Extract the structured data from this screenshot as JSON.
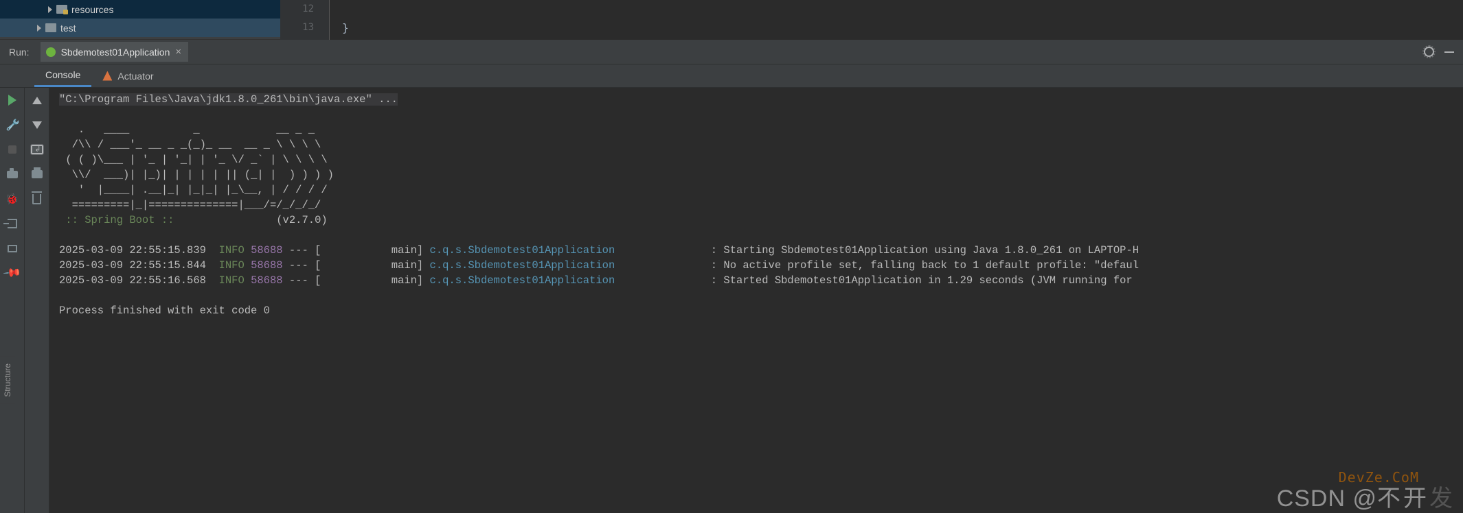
{
  "tree": {
    "items": [
      {
        "label": "resources",
        "special": true,
        "indent": 70
      },
      {
        "label": "test",
        "special": false,
        "indent": 54
      }
    ]
  },
  "gutter": {
    "l1": "12",
    "l2": "13"
  },
  "editor": {
    "l1": "",
    "l2": "}"
  },
  "run": {
    "label": "Run:",
    "tab": "Sbdemotest01Application",
    "tabs": {
      "console": "Console",
      "actuator": "Actuator"
    }
  },
  "console": {
    "cmd": "\"C:\\Program Files\\Java\\jdk1.8.0_261\\bin\\java.exe\" ...",
    "ascii": "   .   ____          _            __ _ _\n  /\\\\ / ___'_ __ _ _(_)_ __  __ _ \\ \\ \\ \\\n ( ( )\\___ | '_ | '_| | '_ \\/ _` | \\ \\ \\ \\\n  \\\\/  ___)| |_)| | | | | || (_| |  ) ) ) )\n   '  |____| .__|_| |_|_| |_\\__, | / / / /\n  =========|_|==============|___/=/_/_/_/",
    "spring_label": " :: Spring Boot :: ",
    "spring_ver": "               (v2.7.0)",
    "logs": [
      {
        "ts": "2025-03-09 22:55:15.839",
        "lvl": "INFO",
        "pid": "58688",
        "thr": "main",
        "cls": "c.q.s.Sbdemotest01Application",
        "msg": "Starting Sbdemotest01Application using Java 1.8.0_261 on LAPTOP-H"
      },
      {
        "ts": "2025-03-09 22:55:15.844",
        "lvl": "INFO",
        "pid": "58688",
        "thr": "main",
        "cls": "c.q.s.Sbdemotest01Application",
        "msg": "No active profile set, falling back to 1 default profile: \"defaul"
      },
      {
        "ts": "2025-03-09 22:55:16.568",
        "lvl": "INFO",
        "pid": "58688",
        "thr": "main",
        "cls": "c.q.s.Sbdemotest01Application",
        "msg": "Started Sbdemotest01Application in 1.29 seconds (JVM running for "
      }
    ],
    "exit": "Process finished with exit code 0"
  },
  "watermark": {
    "text": "CSDN @不",
    "text2": "开",
    "text3": "发",
    "site": "DevZe.CoM"
  },
  "sidebar": {
    "structure": "Structure"
  }
}
